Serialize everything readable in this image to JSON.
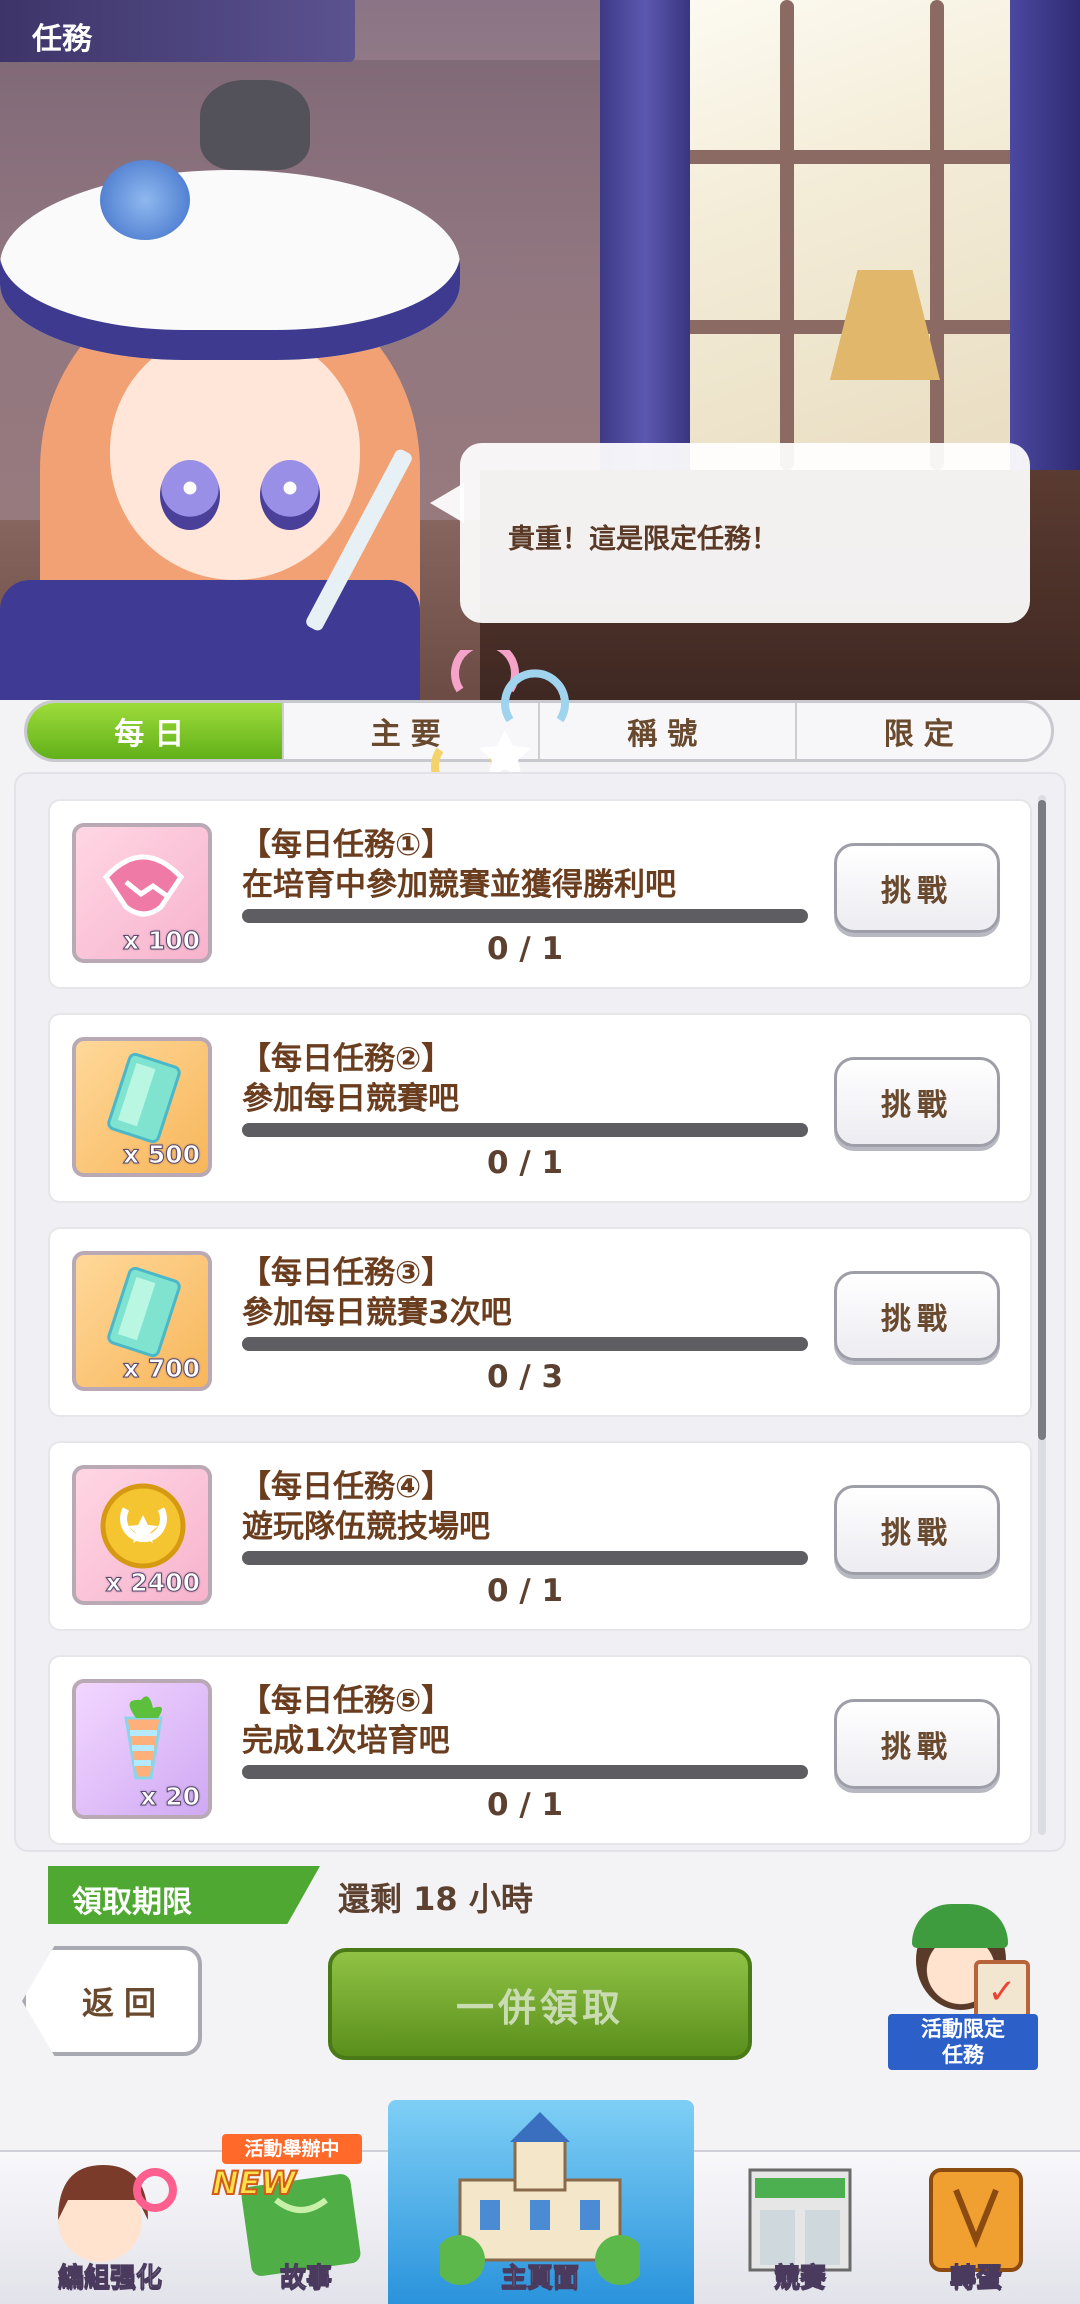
{
  "header": {
    "title": "任務"
  },
  "speech_bubble": "貴重！這是限定任務！",
  "tabs": [
    {
      "label": "每日",
      "active": true
    },
    {
      "label": "主要",
      "active": false
    },
    {
      "label": "稱號",
      "active": false
    },
    {
      "label": "限定",
      "active": false
    }
  ],
  "missions": [
    {
      "title": "【每日任務①】",
      "desc": "在培育中參加競賽並獲得勝利吧",
      "reward_icon": "handshake-icon",
      "reward_qty": "x 100",
      "progress": "0 / 1",
      "progress_fraction": 0,
      "button": "挑戰"
    },
    {
      "title": "【每日任務②】",
      "desc": "參加每日競賽吧",
      "reward_icon": "crystal-ticket-icon",
      "reward_qty": "x 500",
      "progress": "0 / 1",
      "progress_fraction": 0,
      "button": "挑戰"
    },
    {
      "title": "【每日任務③】",
      "desc": "參加每日競賽3次吧",
      "reward_icon": "crystal-ticket-icon",
      "reward_qty": "x 700",
      "progress": "0 / 3",
      "progress_fraction": 0,
      "button": "挑戰"
    },
    {
      "title": "【每日任務④】",
      "desc": "遊玩隊伍競技場吧",
      "reward_icon": "gold-coin-icon",
      "reward_qty": "x 2400",
      "progress": "0 / 1",
      "progress_fraction": 0,
      "button": "挑戰"
    },
    {
      "title": "【每日任務⑤】",
      "desc": "完成1次培育吧",
      "reward_icon": "rainbow-carrot-icon",
      "reward_qty": "x 20",
      "progress": "0 / 1",
      "progress_fraction": 0,
      "button": "挑戰"
    }
  ],
  "deadline": {
    "label": "領取期限",
    "text": "還剩 18 小時"
  },
  "actions": {
    "back": "返回",
    "claim_all": "一併領取",
    "limited_missions": "活動限定\n任務"
  },
  "nav": {
    "event_tag": "活動舉辦中",
    "new_tag": "NEW",
    "items": [
      {
        "label": "編組强化",
        "icon": "character-icon"
      },
      {
        "label": "故事",
        "icon": "book-icon"
      },
      {
        "label": "主頁面",
        "icon": "school-building-icon"
      },
      {
        "label": "競賽",
        "icon": "race-gate-icon"
      },
      {
        "label": "轉蛋",
        "icon": "gacha-icon"
      }
    ]
  },
  "colors": {
    "tab_active": "#62b01a",
    "claim": "#5a8f1c",
    "deadline": "#4fa832",
    "text_brown": "#6a3d1f"
  }
}
